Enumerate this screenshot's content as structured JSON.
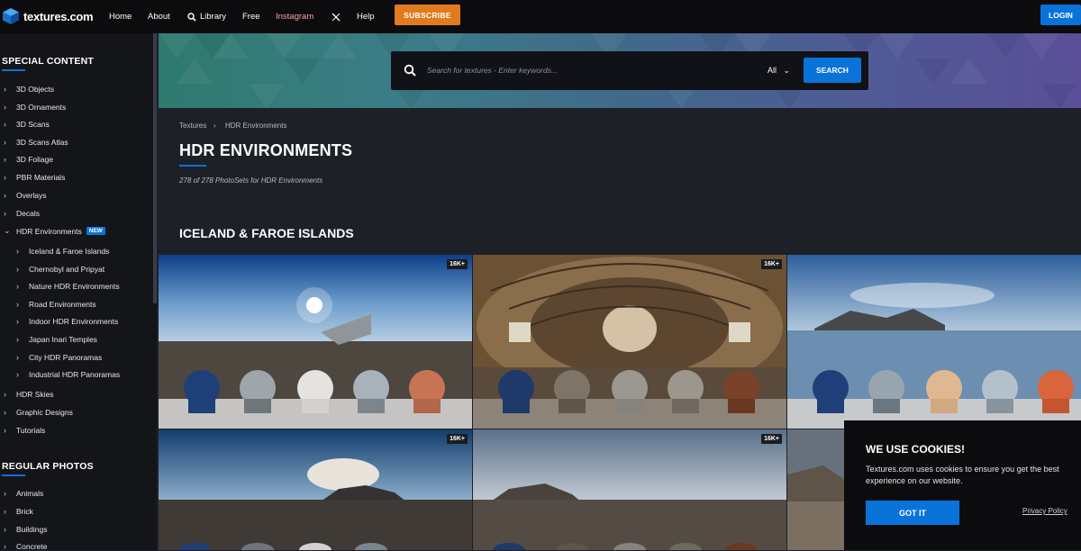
{
  "brand": {
    "name": "textures.com"
  },
  "nav": {
    "home": "Home",
    "about": "About",
    "library": "Library",
    "free": "Free",
    "instagram": "Instagram",
    "help": "Help",
    "subscribe": "SUBSCRIBE",
    "login": "LOGIN"
  },
  "colors": {
    "accent": "#0a73d9",
    "subscribe": "#e07b1f",
    "instagram": "#ff9ea6"
  },
  "sidebar": {
    "special_title": "SPECIAL CONTENT",
    "special_items": [
      {
        "label": "3D Objects",
        "icon": "chevron-right-icon"
      },
      {
        "label": "3D Ornaments",
        "icon": "chevron-right-icon"
      },
      {
        "label": "3D Scans",
        "icon": "chevron-right-icon"
      },
      {
        "label": "3D Scans Atlas",
        "icon": "chevron-right-icon"
      },
      {
        "label": "3D Foliage",
        "icon": "chevron-right-icon"
      },
      {
        "label": "PBR Materials",
        "icon": "chevron-right-icon"
      },
      {
        "label": "Overlays",
        "icon": "chevron-right-icon"
      },
      {
        "label": "Decals",
        "icon": "chevron-right-icon"
      },
      {
        "label": "HDR Environments",
        "icon": "chevron-down-icon",
        "badge": "NEW"
      }
    ],
    "hdr_sub_items": [
      "Iceland & Faroe Islands",
      "Chernobyl and Pripyat",
      "Nature HDR Environments",
      "Road Environments",
      "Indoor HDR Environments",
      "Japan Inari Temples",
      "City HDR Panoramas",
      "Industrial HDR Panoramas"
    ],
    "more_items": [
      "HDR Skies",
      "Graphic Designs",
      "Tutorials"
    ],
    "regular_title": "REGULAR PHOTOS",
    "regular_items": [
      "Animals",
      "Brick",
      "Buildings",
      "Concrete"
    ]
  },
  "search": {
    "placeholder": "Search for textures - Enter keywords...",
    "filter": "All",
    "button": "SEARCH"
  },
  "breadcrumb": {
    "root": "Textures",
    "current": "HDR Environments"
  },
  "page": {
    "title": "HDR ENVIRONMENTS",
    "count": "278 of 278 PhotoSets for HDR Environments",
    "section_title": "ICELAND & FAROE ISLANDS"
  },
  "thumbnails": [
    {
      "badge": "16K+",
      "scene": "plane-wreck-beach"
    },
    {
      "badge": "16K+",
      "scene": "plane-interior"
    },
    {
      "badge": "",
      "scene": "mountain-lake"
    },
    {
      "badge": "16K+",
      "scene": "mountain-beach-sunset"
    },
    {
      "badge": "16K+",
      "scene": "mountain-beach-overcast"
    },
    {
      "badge": "",
      "scene": "rocky-hills"
    }
  ],
  "cookie": {
    "title": "WE USE COOKIES!",
    "text": "Textures.com uses cookies to ensure you get the best experience on our website.",
    "button": "GOT IT",
    "policy": "Privacy Policy"
  }
}
